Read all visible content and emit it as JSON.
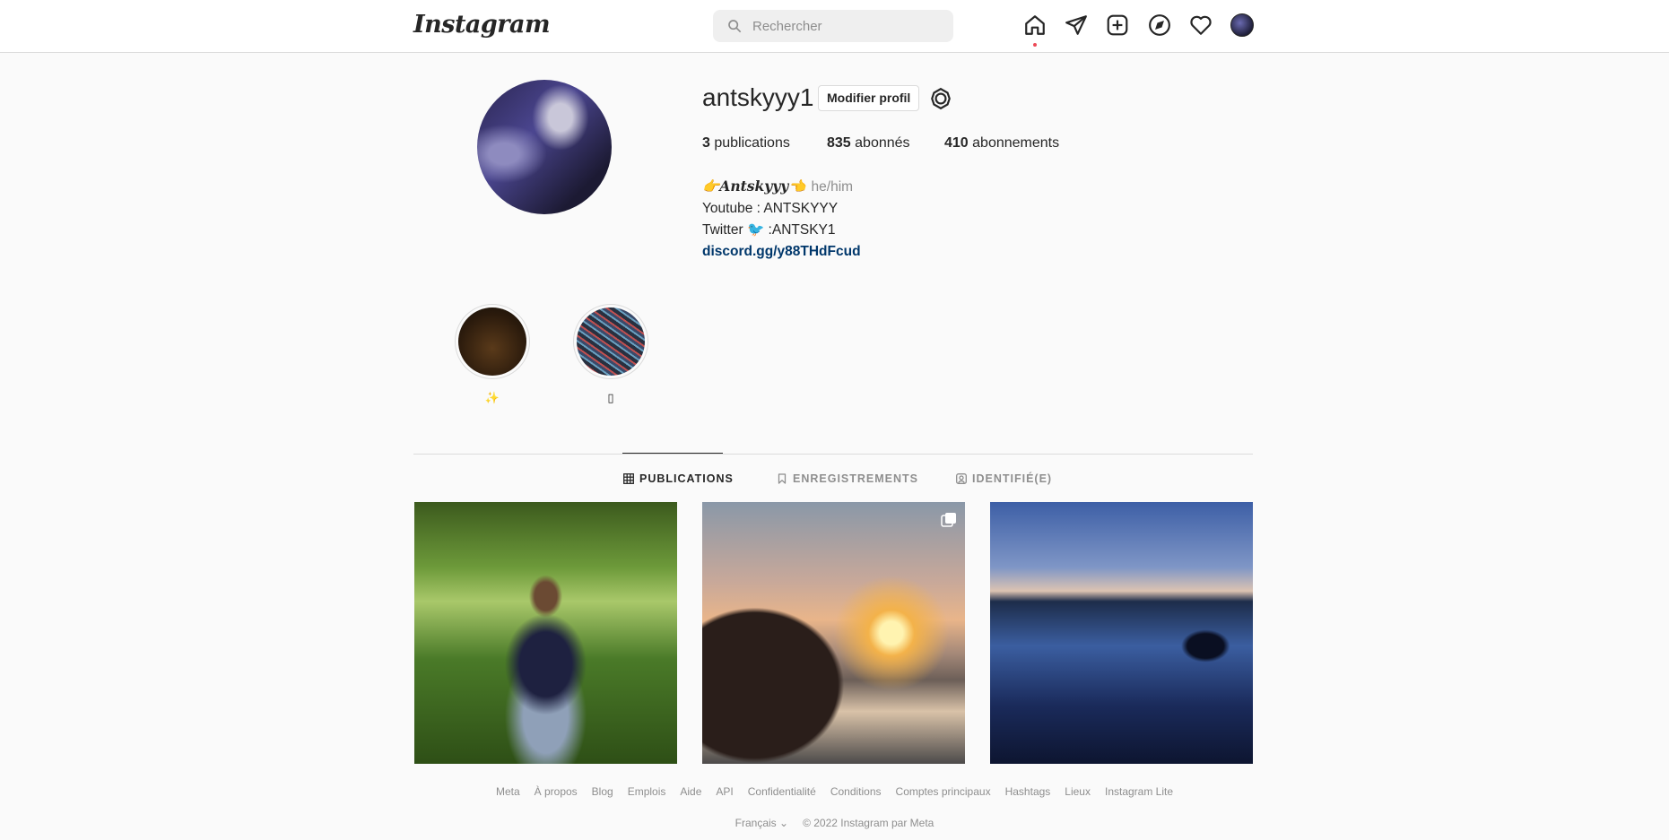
{
  "header": {
    "logo": "Instagram",
    "search_placeholder": "Rechercher",
    "icons": [
      "home-icon",
      "direct-message-icon",
      "new-post-icon",
      "explore-icon",
      "activity-heart-icon",
      "profile-avatar"
    ]
  },
  "profile": {
    "username": "antskyyy1",
    "edit_label": "Modifier profil",
    "stats": {
      "posts_count": "3",
      "posts_label": " publications",
      "followers_count": "835",
      "followers_label": " abonnés",
      "following_count": "410",
      "following_label": " abonnements"
    },
    "bio": {
      "name": "👉𝑨𝒏𝒕𝒔𝒌𝒚𝒚𝒚👈",
      "pronouns": "he/him",
      "line1": "Youtube : ANTSKYYY",
      "line2": "Twitter 🐦 :ANTSKY1",
      "link": "discord.gg/y88THdFcud"
    }
  },
  "highlights": [
    {
      "label": "✨"
    },
    {
      "label": "▯"
    }
  ],
  "tabs": [
    {
      "label": "PUBLICATIONS",
      "active": true
    },
    {
      "label": "ENREGISTREMENTS",
      "active": false
    },
    {
      "label": "IDENTIFIÉ(E)",
      "active": false
    }
  ],
  "footer": {
    "links": [
      "Meta",
      "À propos",
      "Blog",
      "Emplois",
      "Aide",
      "API",
      "Confidentialité",
      "Conditions",
      "Comptes principaux",
      "Hashtags",
      "Lieux",
      "Instagram Lite"
    ],
    "language": "Français",
    "copyright": "© 2022 Instagram par Meta"
  },
  "colors": {
    "link": "#00376b",
    "notification_dot": "#ed4956",
    "border": "#dbdbdb"
  }
}
